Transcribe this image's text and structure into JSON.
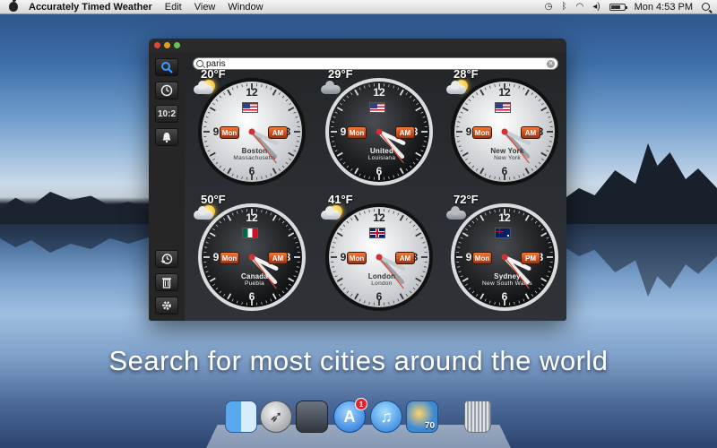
{
  "menubar": {
    "app_name": "Accurately Timed Weather",
    "items": [
      "Edit",
      "View",
      "Window"
    ],
    "time": "Mon 4:53 PM"
  },
  "search": {
    "value": "paris",
    "clear_glyph": "✕"
  },
  "toolbar": {
    "time_format_label": "10:2"
  },
  "clocks": [
    {
      "temp": "20°F",
      "weather": "partly-cloudy",
      "day": "Mon",
      "ampm": "AM",
      "city": "Boston",
      "region": "Massachusetts",
      "flag": "us",
      "face": "light",
      "hour_angle": 140,
      "minute_angle": 147
    },
    {
      "temp": "29°F",
      "weather": "cloudy",
      "day": "Mon",
      "ampm": "AM",
      "city": "United",
      "region": "Louisiana",
      "flag": "us",
      "face": "dark",
      "hour_angle": 140,
      "minute_angle": 147
    },
    {
      "temp": "28°F",
      "weather": "partly-cloudy",
      "day": "Mon",
      "ampm": "AM",
      "city": "New York",
      "region": "New York",
      "flag": "us",
      "face": "light",
      "hour_angle": 140,
      "minute_angle": 147
    },
    {
      "temp": "50°F",
      "weather": "partly-cloudy",
      "day": "Mon",
      "ampm": "AM",
      "city": "Canada",
      "region": "Puebla",
      "flag": "mx",
      "face": "dark",
      "hour_angle": 140,
      "minute_angle": 147
    },
    {
      "temp": "41°F",
      "weather": "partly-cloudy",
      "day": "Mon",
      "ampm": "AM",
      "city": "London",
      "region": "London",
      "flag": "uk",
      "face": "light",
      "hour_angle": 140,
      "minute_angle": 147
    },
    {
      "temp": "72°F",
      "weather": "cloudy",
      "day": "Mon",
      "ampm": "PM",
      "city": "Sydney",
      "region": "New South Wales",
      "flag": "au",
      "face": "dark",
      "hour_angle": 140,
      "minute_angle": 147
    }
  ],
  "clock_numerals": {
    "top": "12",
    "right": "3",
    "bottom": "6",
    "left": "9"
  },
  "caption": "Search for most cities around the world",
  "dock": {
    "appstore_badge": "1",
    "weather_temp": "70"
  },
  "colors": {
    "accent_orange": "#e06a2a",
    "toolbar_active": "#2f7fd6",
    "window_bg": "#2a2a2b"
  }
}
